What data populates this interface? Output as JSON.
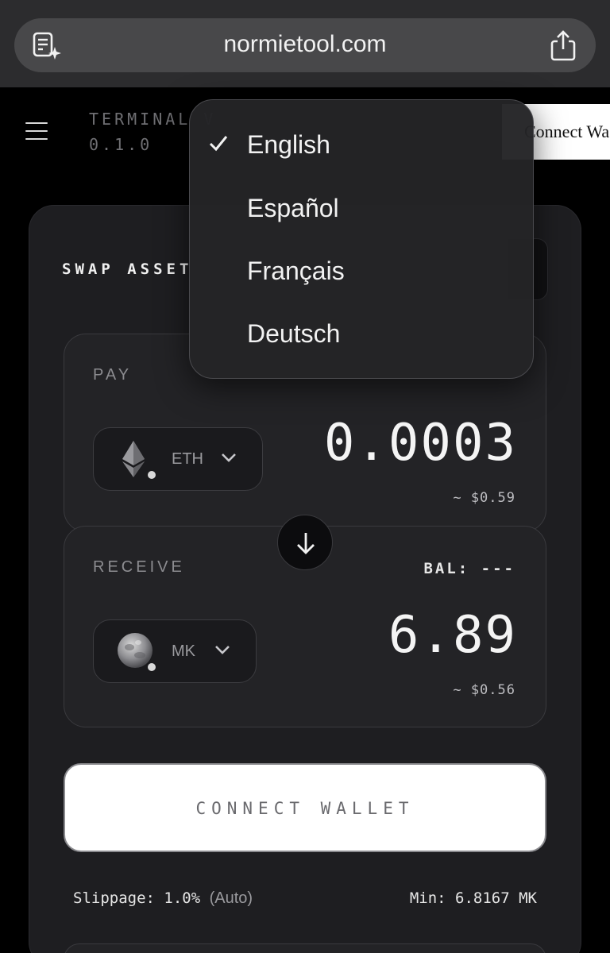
{
  "browser": {
    "url": "normietool.com",
    "reader_icon": "reader-mode-icon",
    "share_icon": "share-icon"
  },
  "header": {
    "title": "TERMINAL V",
    "version": "0.1.0",
    "connect_label": "Connect Wa"
  },
  "swap": {
    "title": "SWAP ASSET",
    "pay": {
      "label": "PAY",
      "token": "ETH",
      "amount": "0.0003",
      "usd": "~ $0.59"
    },
    "receive": {
      "label": "RECEIVE",
      "balance": "BAL: ---",
      "token": "MK",
      "amount": "6.89",
      "usd": "~ $0.56"
    },
    "connect_wallet": "CONNECT WALLET",
    "slippage_label": "Slippage: 1.0%",
    "slippage_mode": "(Auto)",
    "min_received": "Min: 6.8167 MK"
  },
  "language_menu": {
    "items": [
      {
        "label": "English",
        "selected": true
      },
      {
        "label": "Español",
        "selected": false
      },
      {
        "label": "Français",
        "selected": false
      },
      {
        "label": "Deutsch",
        "selected": false
      }
    ]
  },
  "colors": {
    "background": "#000000",
    "card": "#1e1e21",
    "panel": "#232326",
    "accent": "#ffffff"
  }
}
